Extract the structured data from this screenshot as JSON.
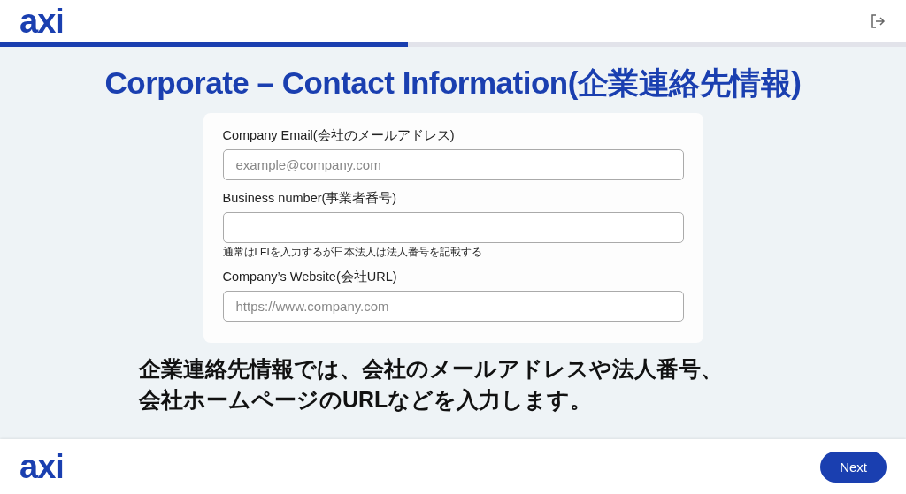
{
  "header": {
    "logo": "axi",
    "progress": {
      "level": 0.45
    }
  },
  "title": "Corporate – Contact Information(企業連絡先情報)",
  "form": {
    "fields": [
      {
        "label": "Company Email(会社のメールアドレス)",
        "placeholder": "example@company.com"
      },
      {
        "label": "Business number(事業者番号)",
        "hint": "通常はLEIを入力するが日本法人は法人番号を記載する"
      },
      {
        "label": "Company’s Website(会社URL)",
        "placeholder": "https://www.company.com"
      }
    ]
  },
  "caption": [
    "企業連絡先情報では、会社のメールアドレスや法人番号、",
    "会社ホームページのURLなどを入力します。"
  ],
  "footer": {
    "logo": "axi",
    "next_button": "Next"
  }
}
